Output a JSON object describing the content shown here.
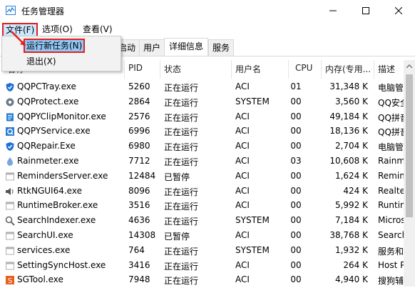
{
  "window": {
    "title": "任务管理器"
  },
  "menu": {
    "file": "文件(F)",
    "options": "选项(O)",
    "view": "查看(V)"
  },
  "file_menu": {
    "items": [
      "运行新任务(N)",
      "退出(X)"
    ]
  },
  "tabs": [
    "启动",
    "用户",
    "详细信息",
    "服务"
  ],
  "columns": {
    "name": "名称",
    "pid": "PID",
    "status": "状态",
    "user": "用户名",
    "cpu": "CPU",
    "memory": "内存(专用...",
    "desc": "描述"
  },
  "rows": [
    {
      "name": "QQPCTray.exe",
      "pid": "5260",
      "status": "正在运行",
      "user": "ACI",
      "cpu": "01",
      "mem": "31,348 K",
      "desc": "电脑管",
      "icon": "shield-icon",
      "iconColor": "#1e6fd9"
    },
    {
      "name": "QQProtect.exe",
      "pid": "2864",
      "status": "正在运行",
      "user": "SYSTEM",
      "cpu": "00",
      "mem": "3,560 K",
      "desc": "QQ安全",
      "icon": "gear-icon",
      "iconColor": "#6a7a8a"
    },
    {
      "name": "QQPYClipMonitor.exe",
      "pid": "2576",
      "status": "正在运行",
      "user": "ACI",
      "cpu": "00",
      "mem": "49,184 K",
      "desc": "QQ拼音",
      "icon": "clipboard-icon",
      "iconColor": "#2a7fd4"
    },
    {
      "name": "QQPYService.exe",
      "pid": "6996",
      "status": "正在运行",
      "user": "ACI",
      "cpu": "00",
      "mem": "18,136 K",
      "desc": "QQ拼音",
      "icon": "q-icon",
      "iconColor": "#2a7fd4"
    },
    {
      "name": "QQRepair.Exe",
      "pid": "6980",
      "status": "正在运行",
      "user": "ACI",
      "cpu": "00",
      "mem": "2,704 K",
      "desc": "电脑管",
      "icon": "shield-icon",
      "iconColor": "#1e6fd9"
    },
    {
      "name": "Rainmeter.exe",
      "pid": "7712",
      "status": "正在运行",
      "user": "ACI",
      "cpu": "03",
      "mem": "10,608 K",
      "desc": "Rainme",
      "icon": "drop-icon",
      "iconColor": "#7aa7d9"
    },
    {
      "name": "RemindersServer.exe",
      "pid": "12484",
      "status": "已暂停",
      "user": "ACI",
      "cpu": "00",
      "mem": "1,624 K",
      "desc": "Remind",
      "icon": "window-icon",
      "iconColor": "#b0b0b0"
    },
    {
      "name": "RtkNGUI64.exe",
      "pid": "8096",
      "status": "正在运行",
      "user": "ACI",
      "cpu": "00",
      "mem": "424 K",
      "desc": "Realtek",
      "icon": "speaker-icon",
      "iconColor": "#555555"
    },
    {
      "name": "RuntimeBroker.exe",
      "pid": "3516",
      "status": "正在运行",
      "user": "ACI",
      "cpu": "00",
      "mem": "5,992 K",
      "desc": "Runtim",
      "icon": "window-icon",
      "iconColor": "#b0b0b0"
    },
    {
      "name": "SearchIndexer.exe",
      "pid": "4636",
      "status": "正在运行",
      "user": "SYSTEM",
      "cpu": "00",
      "mem": "7,184 K",
      "desc": "Micros",
      "icon": "search-icon",
      "iconColor": "#666666"
    },
    {
      "name": "SearchUI.exe",
      "pid": "14308",
      "status": "已暂停",
      "user": "ACI",
      "cpu": "00",
      "mem": "38,768 K",
      "desc": "Search",
      "icon": "window-icon",
      "iconColor": "#b0b0b0"
    },
    {
      "name": "services.exe",
      "pid": "764",
      "status": "正在运行",
      "user": "SYSTEM",
      "cpu": "00",
      "mem": "1,932 K",
      "desc": "服务和",
      "icon": "window-icon",
      "iconColor": "#b0b0b0"
    },
    {
      "name": "SettingSyncHost.exe",
      "pid": "3416",
      "status": "正在运行",
      "user": "ACI",
      "cpu": "00",
      "mem": "264 K",
      "desc": "Host Pr",
      "icon": "window-icon",
      "iconColor": "#b0b0b0"
    },
    {
      "name": "SGTool.exe",
      "pid": "7948",
      "status": "正在运行",
      "user": "ACI",
      "cpu": "00",
      "mem": "4,940 K",
      "desc": "搜狗辅",
      "icon": "s-icon",
      "iconColor": "#e8601c"
    }
  ]
}
